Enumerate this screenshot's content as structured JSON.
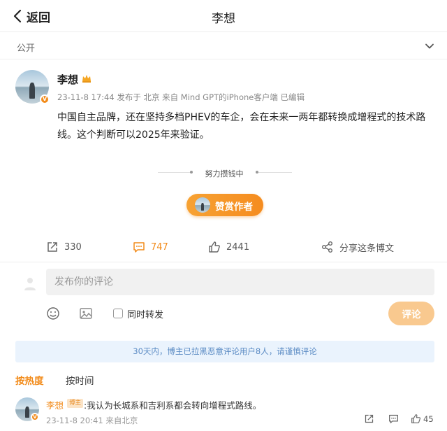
{
  "nav": {
    "back_label": "返回",
    "title": "李想"
  },
  "visibility": {
    "label": "公开"
  },
  "post": {
    "author": "李想",
    "verified_badge": "V",
    "meta": "23-11-8 17:44  发布于 北京  来自 Mind GPT的iPhone客户端 已编辑",
    "content": "中国自主品牌，还在坚持多档PHEV的车企，会在未来一两年都转换成增程式的技术路线。这个判断可以2025年来验证。"
  },
  "reward": {
    "status": "努力攒钱中",
    "button_label": "赞赏作者"
  },
  "actions": {
    "repost_count": "330",
    "comment_count": "747",
    "like_count": "2441",
    "share_label": "分享这条博文"
  },
  "composer": {
    "placeholder": "发布你的评论",
    "also_repost_label": "同时转发",
    "submit_label": "评论"
  },
  "notice": "30天内，博主已拉黑恶意评论用户8人，请谨慎评论",
  "sort": {
    "hot": "按热度",
    "time": "按时间"
  },
  "comments": [
    {
      "author": "李想",
      "tag": "博主",
      "text": ":我认为长城系和吉利系都会转向增程式路线。",
      "meta": "23-11-8 20:41 来自北京",
      "likes": "45"
    }
  ],
  "colors": {
    "accent": "#f28b1a",
    "notice_bg": "#eaf3fd",
    "notice_text": "#5b8bc4"
  }
}
